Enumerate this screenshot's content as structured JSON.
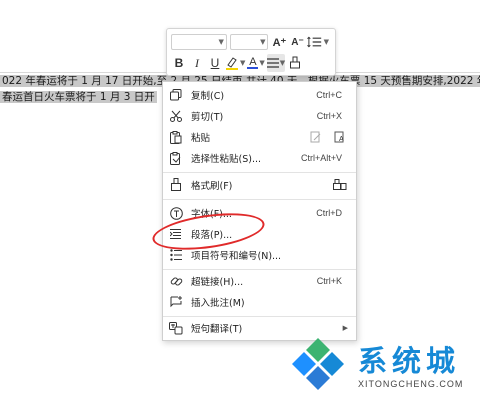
{
  "document": {
    "line1": "022 年春运将于 1 月 17 日开始,至 2 月 25 日结束,共计 40 天。根据火车票 15 天预售期安排,2022 年",
    "line2": "春运首日火车票将于 1 月 3 日开"
  },
  "mini_toolbar": {
    "grow_font": "A⁺",
    "shrink_font": "A⁻",
    "bold": "B",
    "italic": "I",
    "underline": "U",
    "font_color": "A"
  },
  "context_menu": {
    "items": [
      {
        "label": "复制(C)",
        "shortcut": "Ctrl+C",
        "icon": "copy-icon"
      },
      {
        "label": "剪切(T)",
        "shortcut": "Ctrl+X",
        "icon": "scissors-icon"
      },
      {
        "label": "粘贴",
        "shortcut": "",
        "icon": "paste-icon"
      },
      {
        "label": "选择性粘贴(S)...",
        "shortcut": "Ctrl+Alt+V",
        "icon": "paste-special-icon"
      },
      {
        "label": "格式刷(F)",
        "shortcut": "",
        "icon": "format-brush-icon"
      },
      {
        "label": "字体(F)...",
        "shortcut": "Ctrl+D",
        "icon": "font-icon"
      },
      {
        "label": "段落(P)...",
        "shortcut": "",
        "icon": "paragraph-icon"
      },
      {
        "label": "项目符号和编号(N)...",
        "shortcut": "",
        "icon": "bullets-icon"
      },
      {
        "label": "超链接(H)...",
        "shortcut": "Ctrl+K",
        "icon": "link-icon"
      },
      {
        "label": "插入批注(M)",
        "shortcut": "",
        "icon": "comment-icon"
      },
      {
        "label": "短句翻译(T)",
        "shortcut": "",
        "icon": "translate-icon"
      }
    ]
  },
  "watermark": {
    "cn": "系统城",
    "en": "XITONGCHENG.COM"
  },
  "colors": {
    "annotation": "#e02a2a",
    "watermark_blue": "#1689d6",
    "watermark_green": "#3cb371",
    "font_color_bar": "#2b4fd8",
    "highlight_bar": "#f5d400"
  }
}
